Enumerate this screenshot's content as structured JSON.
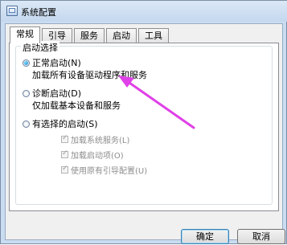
{
  "window": {
    "title": "系统配置"
  },
  "tabs": [
    {
      "label": "常规"
    },
    {
      "label": "引导"
    },
    {
      "label": "服务"
    },
    {
      "label": "启动"
    },
    {
      "label": "工具"
    }
  ],
  "startup_selection": {
    "legend": "启动选择",
    "options": [
      {
        "label": "正常启动(N)",
        "description": "加载所有设备驱动程序和服务",
        "checked": true
      },
      {
        "label": "诊断启动(D)",
        "description": "仅加载基本设备和服务",
        "checked": false
      },
      {
        "label": "有选择的启动(S)",
        "checked": false
      }
    ],
    "selective_items": [
      {
        "label": "加载系统服务(L)",
        "checked": true
      },
      {
        "label": "加载启动项(O)",
        "checked": true
      },
      {
        "label": "使用原有引导配置(U)",
        "checked": true
      }
    ]
  },
  "buttons": {
    "ok": "确定",
    "cancel": "取消"
  },
  "colors": {
    "arrow": "#e040e8",
    "title_bar": "#c9dcf1"
  }
}
